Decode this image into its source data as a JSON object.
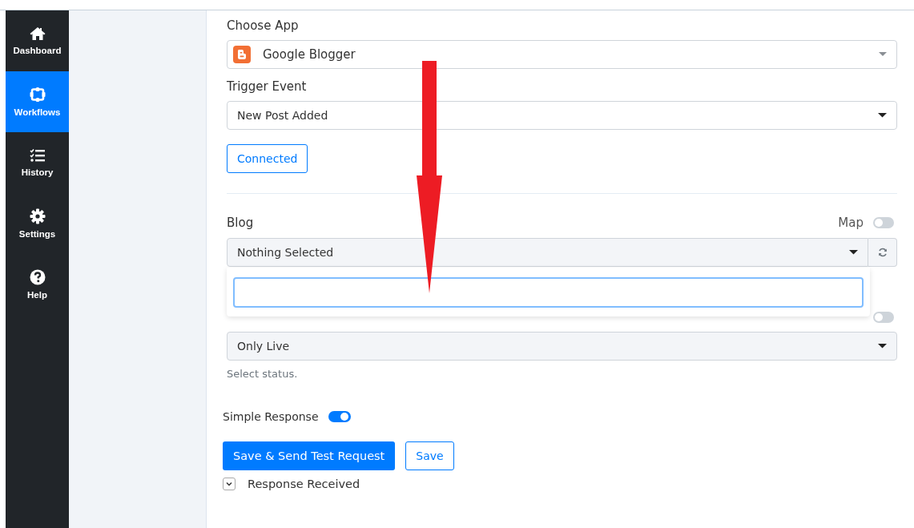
{
  "sidebar": {
    "items": [
      {
        "label": "Dashboard",
        "kind": "home",
        "selected": false
      },
      {
        "label": "Workflows",
        "kind": "workflow",
        "selected": true
      },
      {
        "label": "History",
        "kind": "list",
        "selected": false
      },
      {
        "label": "Settings",
        "kind": "gear",
        "selected": false
      },
      {
        "label": "Help",
        "kind": "help",
        "selected": false
      }
    ]
  },
  "choose_app": {
    "label": "Choose App",
    "value": "Google Blogger"
  },
  "trigger_event": {
    "label": "Trigger Event",
    "value": "New Post Added"
  },
  "connected_button": "Connected",
  "blog": {
    "label": "Blog",
    "map_label": "Map",
    "map_on": false,
    "value": "Nothing Selected"
  },
  "status": {
    "map_on": false,
    "value": "Only Live",
    "hint": "Select status."
  },
  "simple_response": {
    "label": "Simple Response",
    "on": true
  },
  "buttons": [
    "Save & Send Test Request",
    "Save"
  ],
  "response_received": {
    "label": "Response Received",
    "expanded": false
  }
}
